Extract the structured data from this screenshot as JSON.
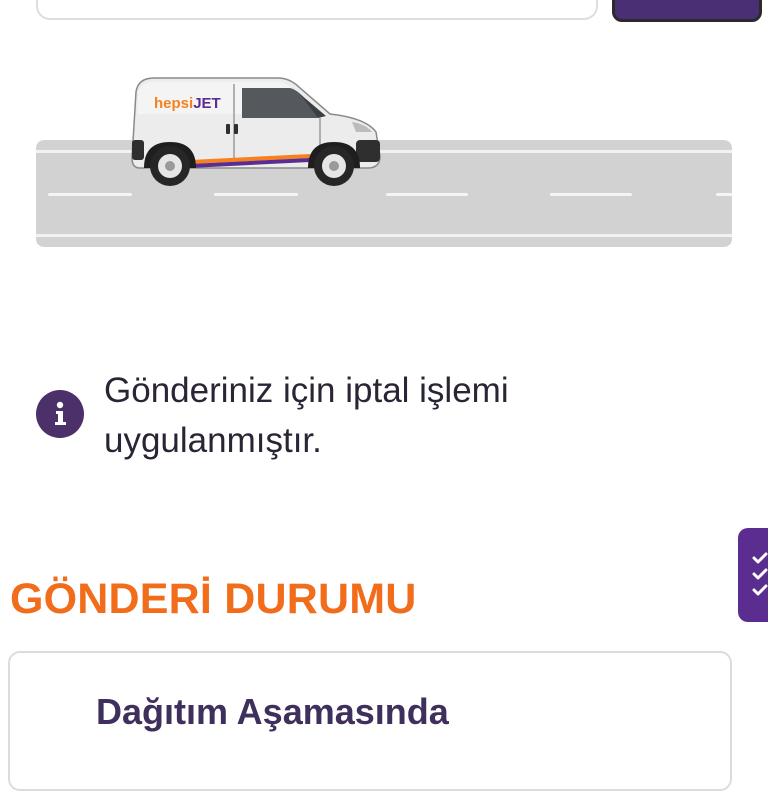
{
  "tracking": {
    "input_value": "",
    "query_label": ""
  },
  "hero": {
    "brand_name": "hepsiJET",
    "brand_color": "#f5821f",
    "brand_accent_color": "#5b2d91"
  },
  "notice": {
    "icon": "info-icon",
    "message": "Gönderiniz için iptal işlemi uygulanmıştır."
  },
  "status_section": {
    "title": "GÖNDERİ DURUMU",
    "side_tab_icon": "checklist-icon",
    "card": {
      "status": "Dağıtım Aşamasında"
    }
  },
  "colors": {
    "primary_purple": "#4b2f74",
    "title_orange": "#f26d1b",
    "road_gray": "#d2d2d2"
  }
}
